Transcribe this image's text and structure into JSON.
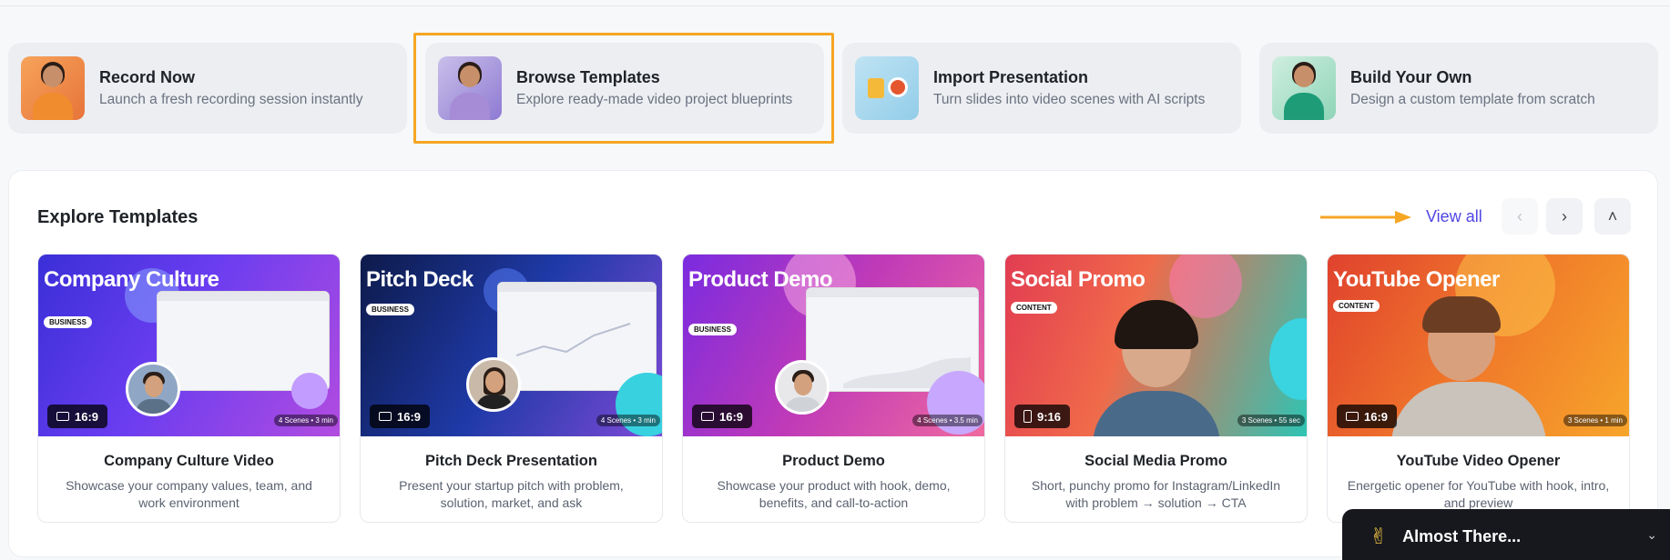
{
  "actions": [
    {
      "title": "Record Now",
      "subtitle": "Launch a fresh recording session instantly",
      "icon": "record-person-thumb"
    },
    {
      "title": "Browse Templates",
      "subtitle": "Explore ready-made video project blueprints",
      "icon": "browse-person-thumb"
    },
    {
      "title": "Import Presentation",
      "subtitle": "Turn slides into video scenes with AI scripts",
      "icon": "import-slides-thumb"
    },
    {
      "title": "Build Your Own",
      "subtitle": "Design a custom template from scratch",
      "icon": "build-person-thumb"
    }
  ],
  "templates_section": {
    "title": "Explore Templates",
    "view_all": "View all",
    "prev_icon": "‹",
    "next_icon": "›",
    "collapse_icon": "˄"
  },
  "templates": [
    {
      "image_title": "Company Culture",
      "category": "BUSINESS",
      "ratio": "16:9",
      "meta": "4 Scenes • 3 min",
      "title": "Company Culture Video",
      "description": "Showcase your company values, team, and work environment"
    },
    {
      "image_title": "Pitch Deck",
      "category": "BUSINESS",
      "ratio": "16:9",
      "meta": "4 Scenes • 3 min",
      "title": "Pitch Deck Presentation",
      "description": "Present your startup pitch with problem, solution, market, and ask"
    },
    {
      "image_title": "Product Demo",
      "category": "BUSINESS",
      "ratio": "16:9",
      "meta": "4 Scenes • 3.5 min",
      "title": "Product Demo",
      "description": "Showcase your product with hook, demo, benefits, and call-to-action"
    },
    {
      "image_title": "Social Promo",
      "category": "CONTENT",
      "ratio": "9:16",
      "meta": "3 Scenes • 55 sec",
      "title": "Social Media Promo",
      "description": "Short, punchy promo for Instagram/LinkedIn with problem → solution → CTA"
    },
    {
      "image_title": "YouTube Opener",
      "category": "CONTENT",
      "ratio": "16:9",
      "meta": "3 Scenes • 1 min",
      "title": "YouTube Video Opener",
      "description": "Energetic opener for YouTube with hook, intro, and preview"
    }
  ],
  "toast": {
    "emoji": "✌",
    "title": "Almost There...",
    "chevron": "⌄"
  },
  "colors": {
    "accent": "#4f46e5",
    "highlight": "#f5a623"
  }
}
